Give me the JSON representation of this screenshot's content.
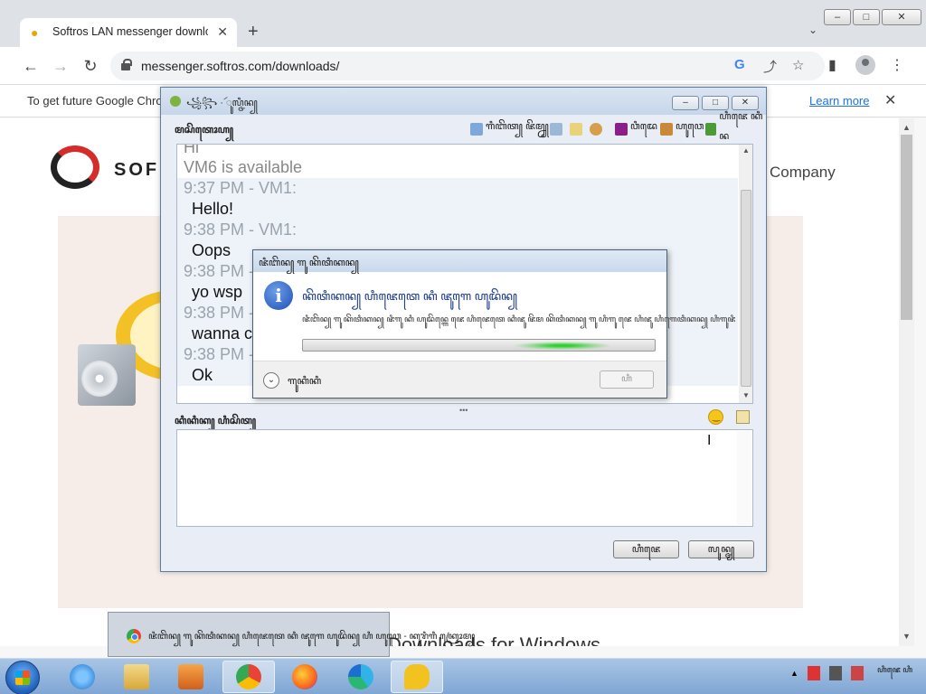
{
  "browser": {
    "tab_title": "Softros LAN messenger downloads",
    "new_tab": "+",
    "url": "messenger.softros.com/downloads/",
    "window_controls": [
      "–",
      "□",
      "✕"
    ],
    "nav": {
      "back": "←",
      "forward": "→",
      "reload": "↻"
    },
    "icons": {
      "google": "G",
      "share": "⤴",
      "bookmark": "☆",
      "sidebar": "▮",
      "menu": "⋮",
      "tab_search": "⌄",
      "tab_close": "✕"
    },
    "infobar": {
      "text": "To get future Google Chro",
      "learn_more": "Learn more",
      "close": "✕"
    }
  },
  "page": {
    "logo_text": "SOF",
    "company": "Company",
    "downloads_title": "Downloads for Windows"
  },
  "messenger": {
    "title": "꧁꧂ · ꦂꦸꦭ꧀ꦗꦶꦤ꧀",
    "window_controls": [
      "–",
      "□",
      "✕"
    ],
    "toolbar": {
      "label": "ꦩꦱꦼꦠꦺꦴꦲ꧀",
      "status": "ꦒꦶꦧꦼꦠ꧀ ꦗꦼꦩ꧀ꦤ꧀",
      "video": "ꦮꦶꦢꦺ",
      "users": "ꦲꦸꦮꦺ",
      "exit": "ꦲꦶꦗꦺ ꦏꦶꦤ"
    },
    "chat": [
      {
        "kind": "sys",
        "text": "Hi"
      },
      {
        "kind": "sys",
        "text": "VM6 is available"
      },
      {
        "kind": "hdr",
        "text": "9:37 PM - VM1:"
      },
      {
        "kind": "msg",
        "text": "Hello!"
      },
      {
        "kind": "hdr",
        "text": "9:38 PM - VM1:"
      },
      {
        "kind": "msg",
        "text": "Oops"
      },
      {
        "kind": "hdr",
        "text": "9:38 PM -"
      },
      {
        "kind": "msg",
        "text": "yo wsp"
      },
      {
        "kind": "hdr",
        "text": "9:38 PM -"
      },
      {
        "kind": "msg",
        "text": "wanna c"
      },
      {
        "kind": "hdr",
        "text": "9:38 PM -"
      },
      {
        "kind": "msg",
        "text": "Ok"
      }
    ],
    "compose_label": "ꦏꦶꦏꦶꦏ꧀ ꦲꦶꦱꦼꦠ꧀",
    "buttons": {
      "send": "ꦲꦶꦗꦺ",
      "close": "ꦭꦸꦤ꧀ꦗ꧀"
    }
  },
  "dialog": {
    "title": "ꦗꦶꦧꦼꦤ꧀ ꦒꦸ ꦏꦼꦠꦶꦏꦤ꧀",
    "heading": "ꦏꦼꦠꦶꦏꦤ꧀ ꦲꦶꦗꦺꦠꦺ ꦏꦶ ꦗꦸꦒꦺ ꦲꦸꦢꦼꦤ꧀",
    "body": "ꦗꦶꦧꦼꦤ꧀ ꦒꦸ ꦏꦼꦠꦶꦏꦤ꧀ ꦗꦶꦒꦸ ꦏꦶ ꦲꦸꦢꦼꦤ꧀ꦒꦺ ꦗꦺ ꦲꦶꦗꦺꦠꦺ ꦏꦶꦗꦸ ꦗꦼꦩ ꦏꦼꦠꦶꦏꦤ꧀ ꦒꦸ ꦲꦶꦒꦸ ꦗꦺ ꦲꦶꦗꦸ ꦲꦶꦒꦺꦠꦶꦏꦤ꧀ ꦲꦶꦒꦸꦗꦶ",
    "progress": 0.75,
    "details": "ꦒꦸꦏꦶꦏꦶ",
    "button": "ꦲꦶ"
  },
  "taskbar": {
    "preview_title": "ꦗꦶꦧꦼꦤ꧀ ꦒꦸ ꦏꦼꦠꦶꦏꦤ꧀ ꦲꦶꦗꦺꦠꦺ ꦏꦶ ꦗꦸꦒꦺ ꦲꦸꦢꦼꦤ꧀ ꦲꦶ ꦲꦸꦮꦺ - ꦏꦸꦫꦶꦒꦶ ꦏꦿꦺꦴꦩ꧀",
    "clock": "ꦲꦶꦗꦺ ꦲꦶ"
  }
}
